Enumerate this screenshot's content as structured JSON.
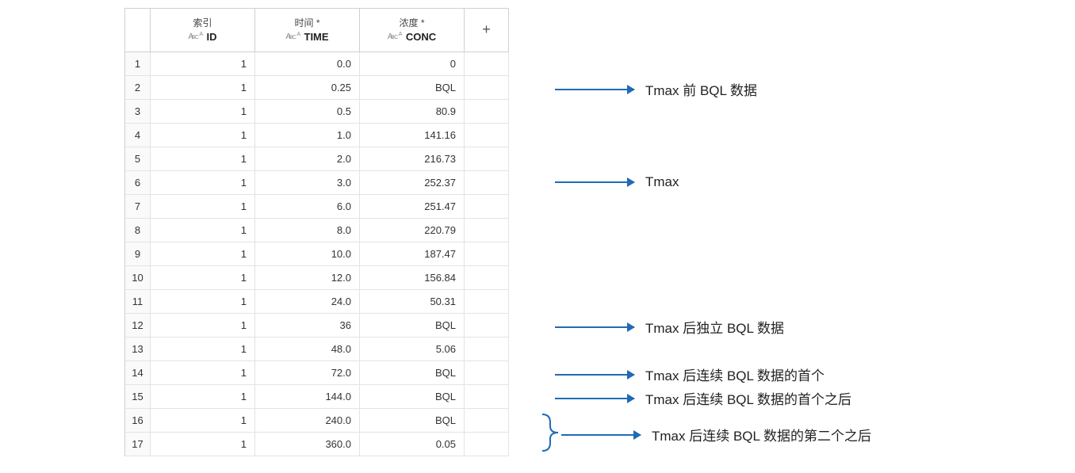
{
  "table": {
    "columns": [
      {
        "top": "索引",
        "name": "ID"
      },
      {
        "top": "时间 *",
        "name": "TIME"
      },
      {
        "top": "浓度 *",
        "name": "CONC"
      }
    ],
    "add_icon": "+",
    "rows": [
      {
        "n": "1",
        "id": "1",
        "time": "0.0",
        "conc": "0"
      },
      {
        "n": "2",
        "id": "1",
        "time": "0.25",
        "conc": "BQL"
      },
      {
        "n": "3",
        "id": "1",
        "time": "0.5",
        "conc": "80.9"
      },
      {
        "n": "4",
        "id": "1",
        "time": "1.0",
        "conc": "141.16"
      },
      {
        "n": "5",
        "id": "1",
        "time": "2.0",
        "conc": "216.73"
      },
      {
        "n": "6",
        "id": "1",
        "time": "3.0",
        "conc": "252.37"
      },
      {
        "n": "7",
        "id": "1",
        "time": "6.0",
        "conc": "251.47"
      },
      {
        "n": "8",
        "id": "1",
        "time": "8.0",
        "conc": "220.79"
      },
      {
        "n": "9",
        "id": "1",
        "time": "10.0",
        "conc": "187.47"
      },
      {
        "n": "10",
        "id": "1",
        "time": "12.0",
        "conc": "156.84"
      },
      {
        "n": "11",
        "id": "1",
        "time": "24.0",
        "conc": "50.31"
      },
      {
        "n": "12",
        "id": "1",
        "time": "36",
        "conc": "BQL"
      },
      {
        "n": "13",
        "id": "1",
        "time": "48.0",
        "conc": "5.06"
      },
      {
        "n": "14",
        "id": "1",
        "time": "72.0",
        "conc": "BQL"
      },
      {
        "n": "15",
        "id": "1",
        "time": "144.0",
        "conc": "BQL"
      },
      {
        "n": "16",
        "id": "1",
        "time": "240.0",
        "conc": "BQL"
      },
      {
        "n": "17",
        "id": "1",
        "time": "360.0",
        "conc": "0.05"
      }
    ]
  },
  "annotations": [
    {
      "label": "Tmax 前 BQL 数据",
      "row": 2,
      "type": "arrow"
    },
    {
      "label": "Tmax",
      "row": 6,
      "type": "arrow"
    },
    {
      "label": "Tmax 后独立 BQL 数据",
      "row": 12,
      "type": "arrow"
    },
    {
      "label": "Tmax 后连续 BQL 数据的首个",
      "row": 14,
      "type": "arrow"
    },
    {
      "label": "Tmax 后连续 BQL 数据的首个之后",
      "row": 15,
      "type": "arrow"
    },
    {
      "label": "Tmax 后连续 BQL 数据的第二个之后",
      "row_from": 16,
      "row_to": 17,
      "type": "brace"
    }
  ],
  "colors": {
    "arrow": "#1f6bb5"
  }
}
